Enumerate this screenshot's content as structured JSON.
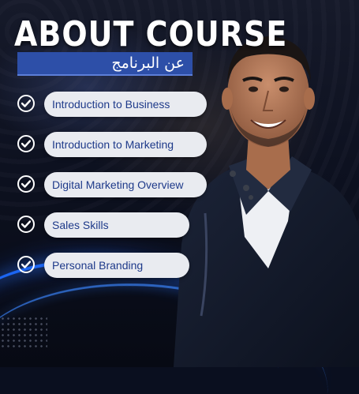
{
  "header": {
    "title": "ABOUT COURSE",
    "subtitle": "عن البرنامج"
  },
  "course_topics": [
    {
      "label": "Introduction to Business"
    },
    {
      "label": "Introduction to Marketing"
    },
    {
      "label": "Digital Marketing Overview"
    },
    {
      "label": "Sales Skills"
    },
    {
      "label": "Personal Branding"
    }
  ],
  "icons": {
    "topic_marker": "check-circle-icon"
  },
  "colors": {
    "accent_blue": "#2d4fa8",
    "pill_text": "#1e3a8a",
    "pill_bg": "#e9ebf0",
    "glow_blue": "#1e6bff"
  }
}
